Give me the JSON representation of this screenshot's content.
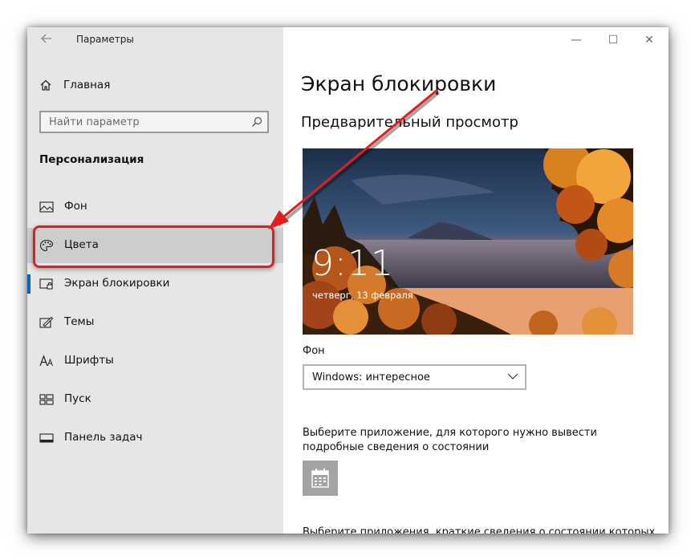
{
  "window": {
    "title": "Параметры",
    "controls": {
      "minimize": "—",
      "maximize": "☐",
      "close": "✕"
    }
  },
  "sidebar": {
    "home_label": "Главная",
    "search_placeholder": "Найти параметр",
    "section_title": "Персонализация",
    "items": [
      {
        "label": "Фон",
        "icon": "picture-icon"
      },
      {
        "label": "Цвета",
        "icon": "palette-icon"
      },
      {
        "label": "Экран блокировки",
        "icon": "lock-screen-icon"
      },
      {
        "label": "Темы",
        "icon": "themes-icon"
      },
      {
        "label": "Шрифты",
        "icon": "fonts-icon"
      },
      {
        "label": "Пуск",
        "icon": "start-icon"
      },
      {
        "label": "Панель задач",
        "icon": "taskbar-icon"
      }
    ]
  },
  "main": {
    "page_title": "Экран блокировки",
    "preview_title": "Предварительный просмотр",
    "preview": {
      "time": "9:11",
      "date": "четверг, 13 февраля"
    },
    "background_label": "Фон",
    "background_value": "Windows: интересное",
    "detailed_status_text": "Выберите приложение, для которого нужно вывести подробные сведения о состоянии",
    "quick_status_text": "Выберите приложения, краткие сведения о состоянии которых"
  },
  "colors": {
    "accent": "#0a64b8",
    "highlight": "#e01e1e",
    "sidebar_bg": "#e6e6e6"
  }
}
